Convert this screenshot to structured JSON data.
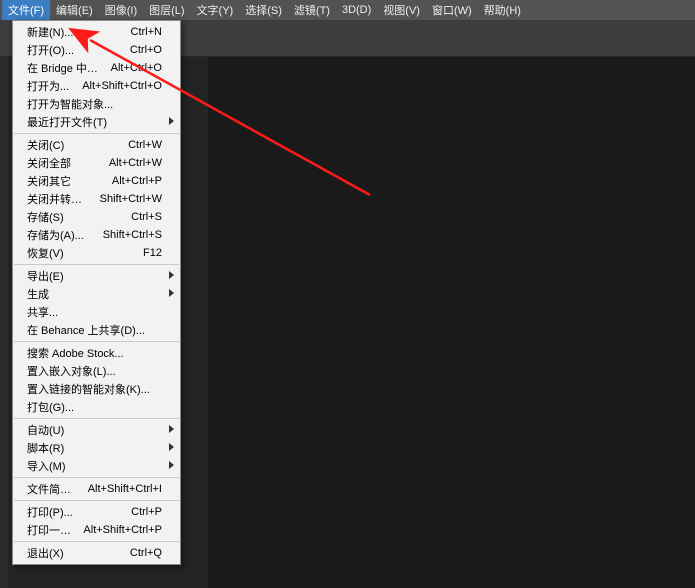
{
  "menubar": {
    "items": [
      {
        "label": "文件(F)",
        "open": true
      },
      {
        "label": "编辑(E)"
      },
      {
        "label": "图像(I)"
      },
      {
        "label": "图层(L)"
      },
      {
        "label": "文字(Y)"
      },
      {
        "label": "选择(S)"
      },
      {
        "label": "滤镜(T)"
      },
      {
        "label": "3D(D)"
      },
      {
        "label": "视图(V)"
      },
      {
        "label": "窗口(W)"
      },
      {
        "label": "帮助(H)"
      }
    ]
  },
  "file_menu": {
    "groups": [
      [
        {
          "label": "新建(N)...",
          "shortcut": "Ctrl+N"
        },
        {
          "label": "打开(O)...",
          "shortcut": "Ctrl+O"
        },
        {
          "label": "在 Bridge 中浏览(B)...",
          "shortcut": "Alt+Ctrl+O"
        },
        {
          "label": "打开为...",
          "shortcut": "Alt+Shift+Ctrl+O"
        },
        {
          "label": "打开为智能对象..."
        },
        {
          "label": "最近打开文件(T)",
          "submenu": true
        }
      ],
      [
        {
          "label": "关闭(C)",
          "shortcut": "Ctrl+W"
        },
        {
          "label": "关闭全部",
          "shortcut": "Alt+Ctrl+W"
        },
        {
          "label": "关闭其它",
          "shortcut": "Alt+Ctrl+P"
        },
        {
          "label": "关闭并转到 Bridge...",
          "shortcut": "Shift+Ctrl+W"
        },
        {
          "label": "存储(S)",
          "shortcut": "Ctrl+S"
        },
        {
          "label": "存储为(A)...",
          "shortcut": "Shift+Ctrl+S"
        },
        {
          "label": "恢复(V)",
          "shortcut": "F12"
        }
      ],
      [
        {
          "label": "导出(E)",
          "submenu": true
        },
        {
          "label": "生成",
          "submenu": true
        },
        {
          "label": "共享..."
        },
        {
          "label": "在 Behance 上共享(D)..."
        }
      ],
      [
        {
          "label": "搜索 Adobe Stock..."
        },
        {
          "label": "置入嵌入对象(L)..."
        },
        {
          "label": "置入链接的智能对象(K)..."
        },
        {
          "label": "打包(G)..."
        }
      ],
      [
        {
          "label": "自动(U)",
          "submenu": true
        },
        {
          "label": "脚本(R)",
          "submenu": true
        },
        {
          "label": "导入(M)",
          "submenu": true
        }
      ],
      [
        {
          "label": "文件简介(F)...",
          "shortcut": "Alt+Shift+Ctrl+I"
        }
      ],
      [
        {
          "label": "打印(P)...",
          "shortcut": "Ctrl+P"
        },
        {
          "label": "打印一份(Y)",
          "shortcut": "Alt+Shift+Ctrl+P"
        }
      ],
      [
        {
          "label": "退出(X)",
          "shortcut": "Ctrl+Q"
        }
      ]
    ]
  },
  "annotation": {
    "desc": "red-arrow-to-open-menu-item"
  }
}
